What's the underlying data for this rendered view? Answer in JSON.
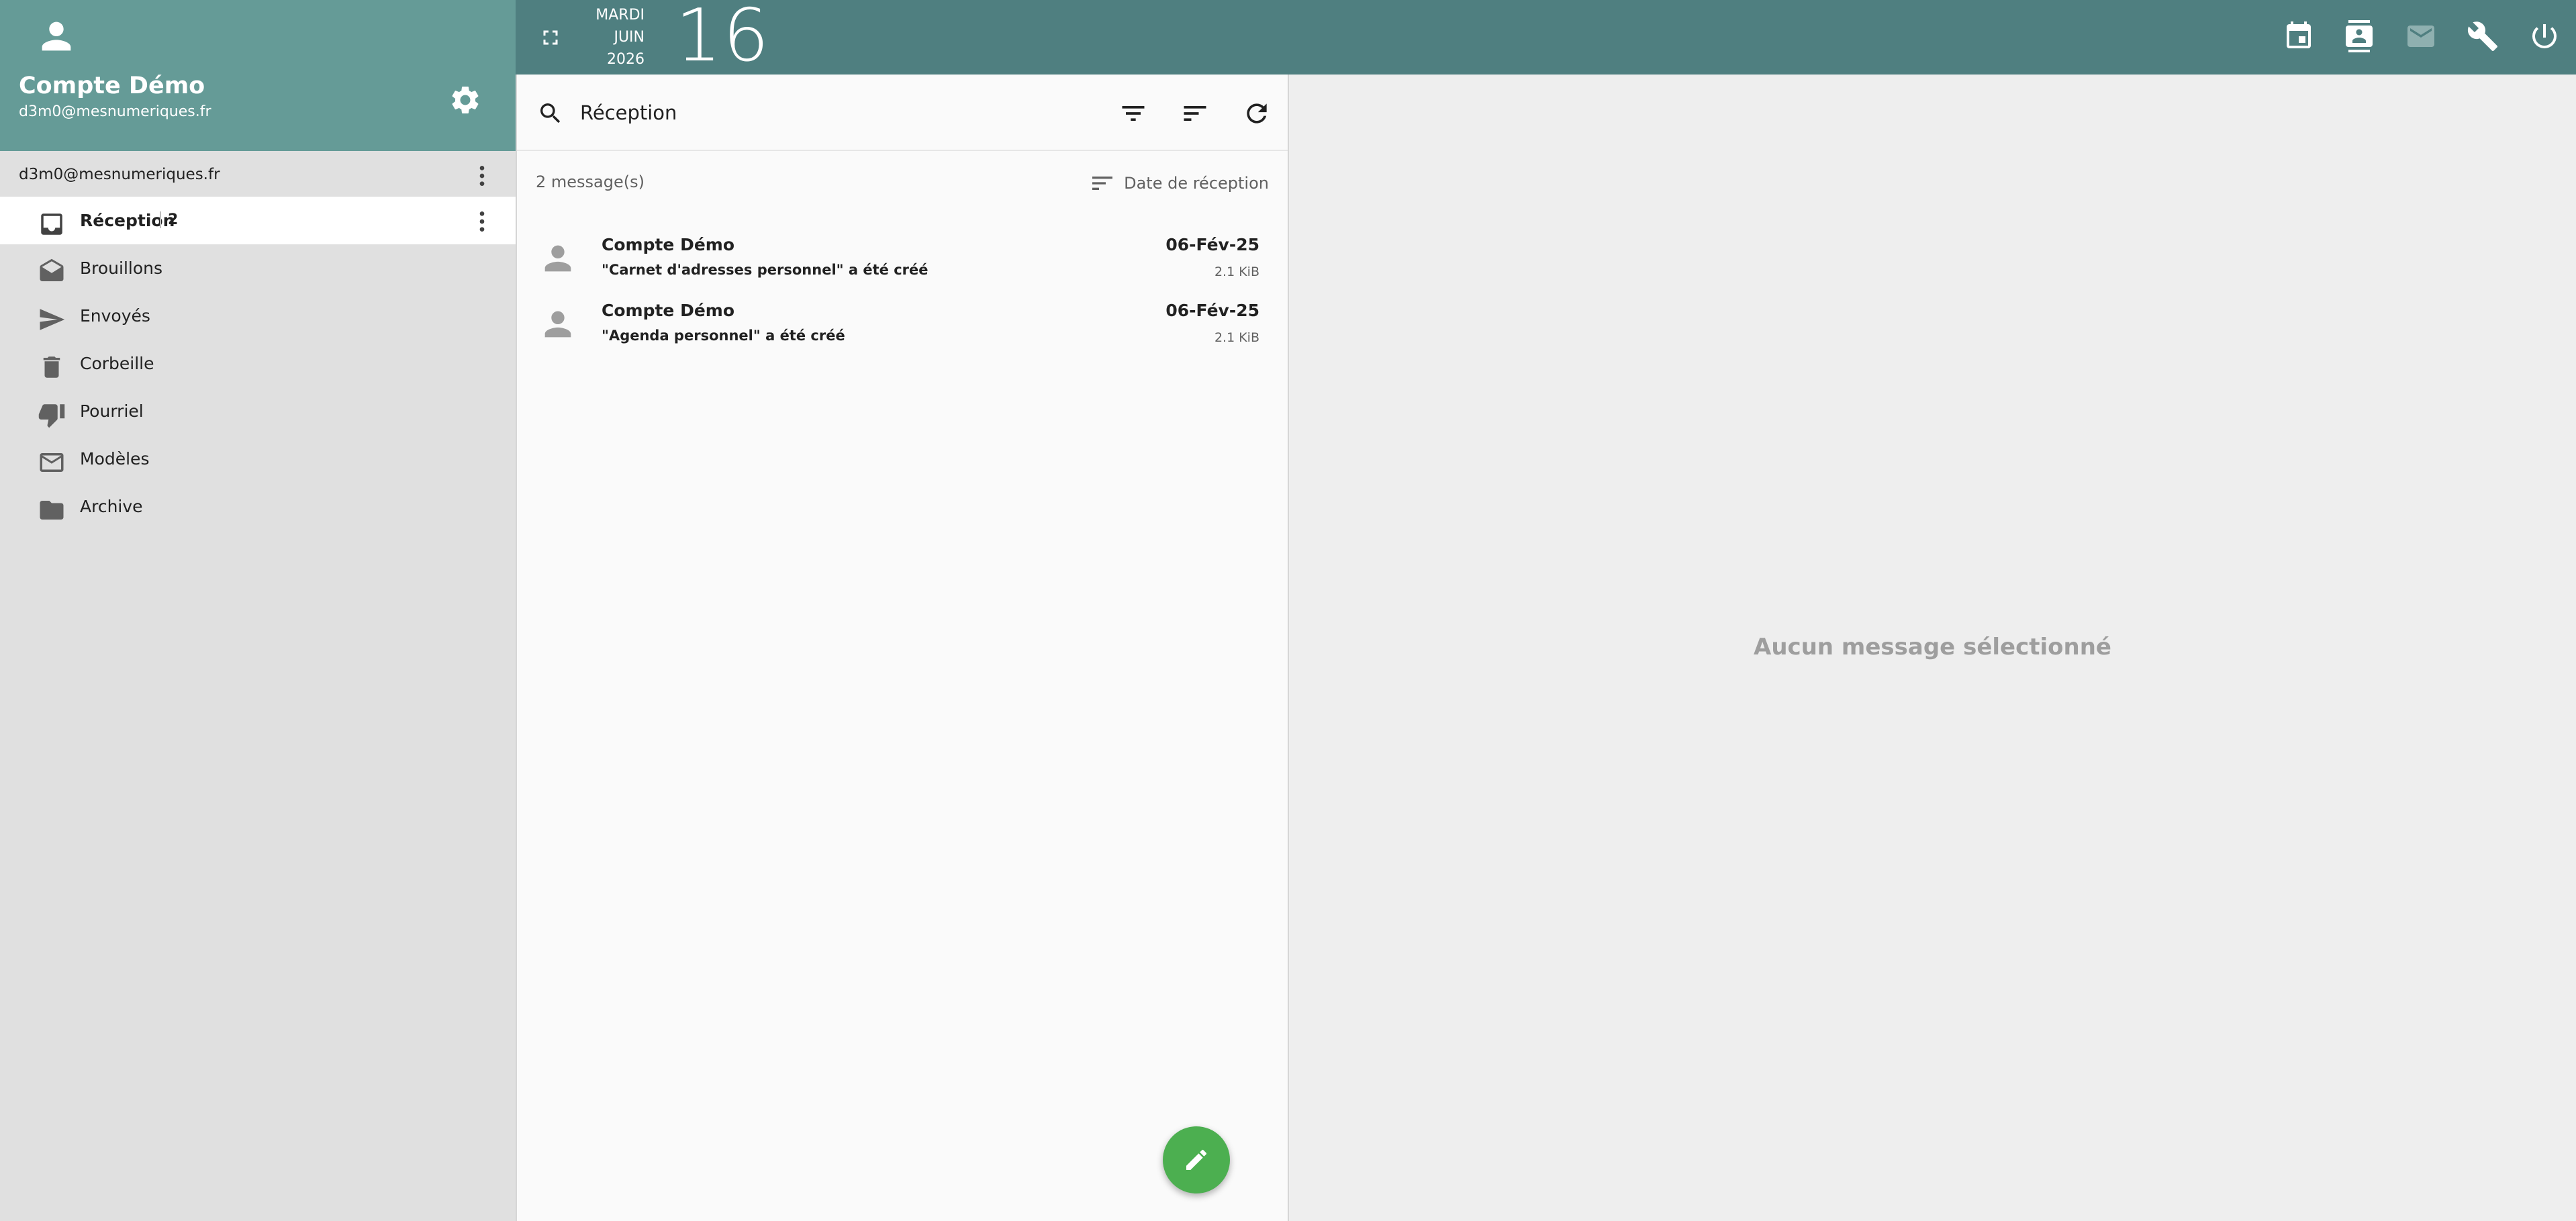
{
  "profile": {
    "name": "Compte Démo",
    "email": "d3m0@mesnumeriques.fr"
  },
  "account": {
    "label": "d3m0@mesnumeriques.fr"
  },
  "folders": [
    {
      "label": "Réception",
      "count": "2",
      "icon": "inbox-icon",
      "active": true
    },
    {
      "label": "Brouillons",
      "icon": "drafts-icon"
    },
    {
      "label": "Envoyés",
      "icon": "send-icon"
    },
    {
      "label": "Corbeille",
      "icon": "trash-icon"
    },
    {
      "label": "Pourriel",
      "icon": "thumb-down-icon"
    },
    {
      "label": "Modèles",
      "icon": "mail-icon"
    },
    {
      "label": "Archive",
      "icon": "folder-icon"
    }
  ],
  "topbar": {
    "weekday": "MARDI",
    "month": "JUIN",
    "year": "2026",
    "day": "16",
    "icons": [
      "calendar-icon",
      "contacts-icon",
      "mail-icon",
      "wrench-icon",
      "power-icon"
    ]
  },
  "list": {
    "search_text": "Réception",
    "count_text": "2 message(s)",
    "sort_label": "Date de réception",
    "messages": [
      {
        "from": "Compte Démo",
        "subject": "\"Carnet d'adresses personnel\" a été créé",
        "date": "06-Fév-25",
        "size": "2.1 KiB"
      },
      {
        "from": "Compte Démo",
        "subject": "\"Agenda personnel\" a été créé",
        "date": "06-Fév-25",
        "size": "2.1 KiB"
      }
    ]
  },
  "reader": {
    "empty_text": "Aucun message sélectionné"
  },
  "colors": {
    "topbar": "#4f7f80",
    "profile": "#659b97",
    "compose": "#4caf50"
  }
}
